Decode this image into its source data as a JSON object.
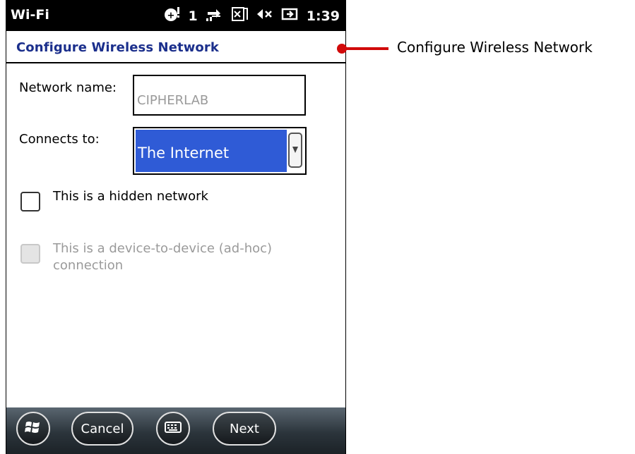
{
  "status_bar": {
    "title": "Wi-Fi",
    "signal_count": "1",
    "time": "1:39"
  },
  "header": {
    "title": "Configure Wireless Network"
  },
  "form": {
    "network_name_label": "Network name:",
    "network_name_value": "CIPHERLAB",
    "connects_to_label": "Connects to:",
    "connects_to_value": "The Internet",
    "hidden_network_label": "This is a hidden network",
    "adhoc_label_line1": "This is a device-to-device (ad-hoc)",
    "adhoc_label_line2": "connection"
  },
  "bottom_bar": {
    "cancel_label": "Cancel",
    "next_label": "Next"
  },
  "callout": {
    "text": "Configure Wireless Network",
    "color": "#d10a0a"
  },
  "colors": {
    "header_text": "#1b2f8c",
    "selection_bg": "#2f5bd6"
  }
}
